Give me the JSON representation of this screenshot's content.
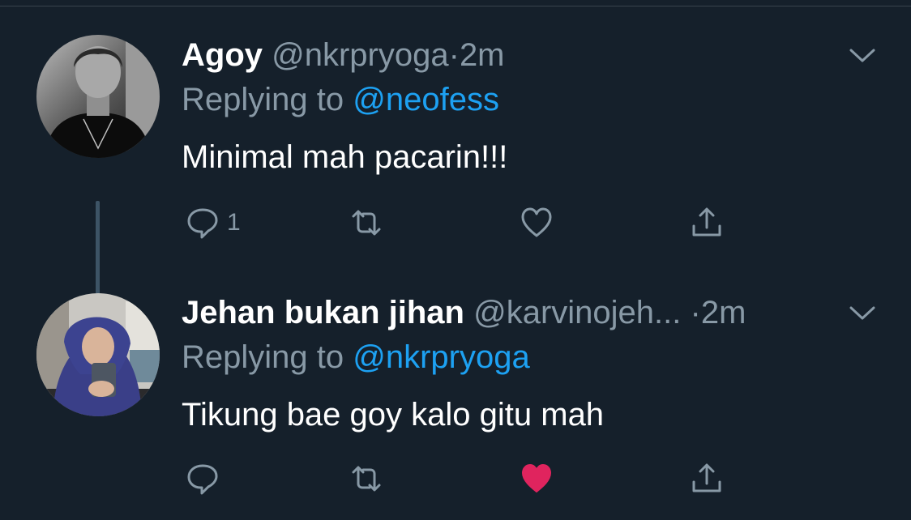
{
  "tweets": [
    {
      "name": "Agoy",
      "handle": "@nkrpryoga",
      "separator": "·",
      "time": "2m",
      "replying_label": "Replying to",
      "replying_to": "@neofess",
      "text": "Minimal mah pacarin!!!",
      "reply_count": "1",
      "liked": false
    },
    {
      "name": "Jehan bukan jihan",
      "handle": "@karvinojeh...",
      "separator": "·",
      "time": "2m",
      "replying_label": "Replying to",
      "replying_to": "@nkrpryoga",
      "text": "Tikung bae goy kalo gitu mah",
      "reply_count": "",
      "liked": true
    }
  ],
  "icons": {
    "reply": "reply-icon",
    "retweet": "retweet-icon",
    "like": "heart-icon",
    "share": "share-icon",
    "more": "chevron-down-icon"
  },
  "colors": {
    "background": "#15202b",
    "secondary_text": "#8899a6",
    "mention": "#1da1f2",
    "liked": "#e0245e",
    "thread_line": "#3d5466"
  }
}
